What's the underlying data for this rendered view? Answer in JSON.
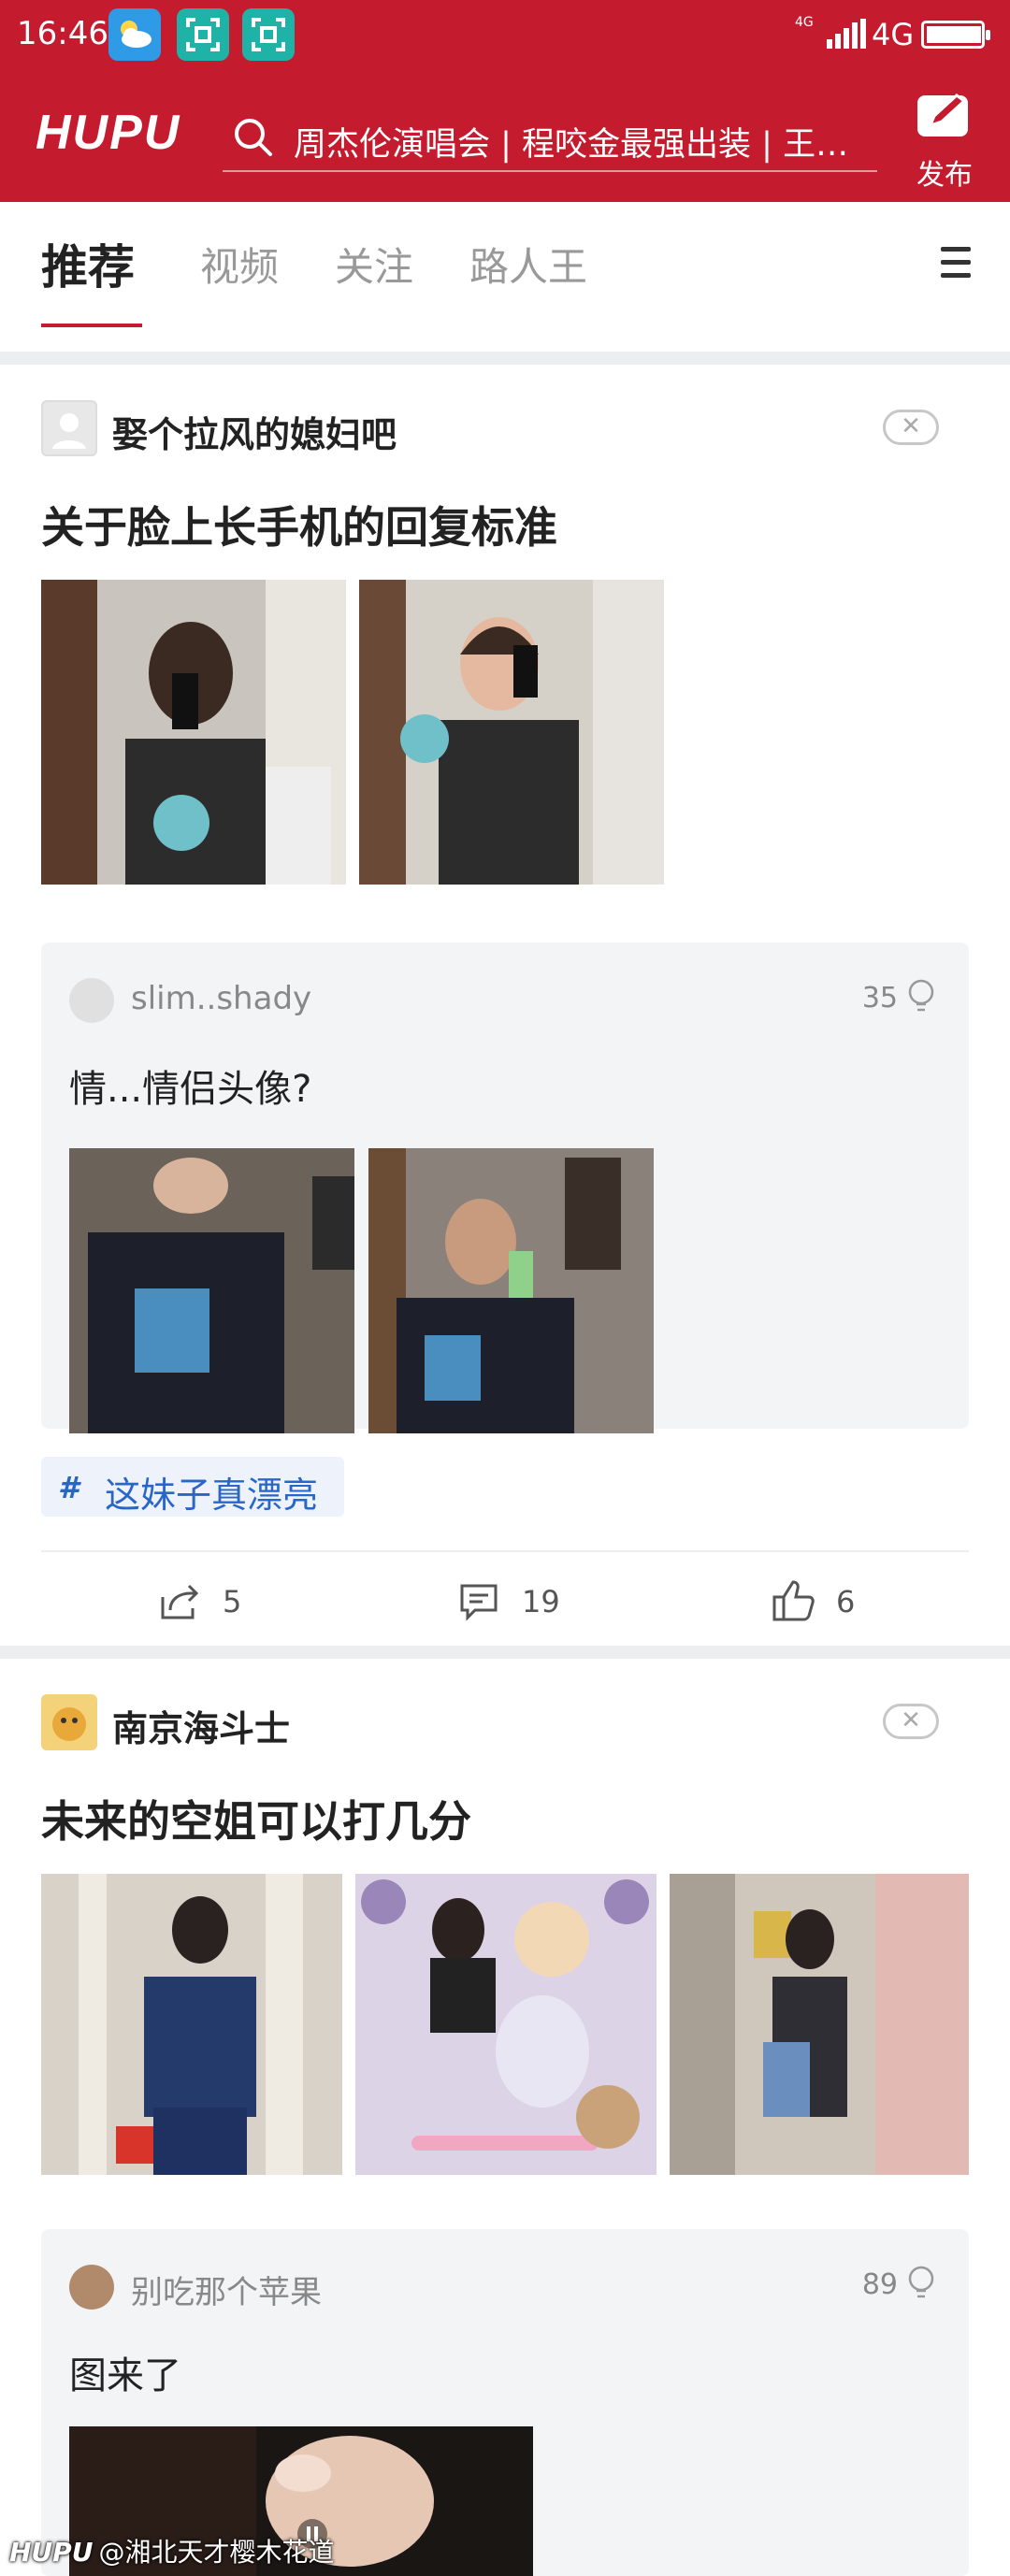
{
  "status": {
    "time": "16:46",
    "network_small": "4G",
    "network": "4G"
  },
  "header": {
    "logo": "HUPU",
    "search_text": "周杰伦演唱会 | 程咬金最强出装 | 王少...",
    "publish_label": "发布"
  },
  "tabs": [
    "推荐",
    "视频",
    "关注",
    "路人王"
  ],
  "posts": [
    {
      "author": "娶个拉风的媳妇吧",
      "title": "关于脸上长手机的回复标准",
      "reply": {
        "user": "slim..shady",
        "likes": "35",
        "text": "情...情侣头像?"
      },
      "tag": "这妹子真漂亮",
      "actions": {
        "share": "5",
        "comment": "19",
        "like": "6"
      }
    },
    {
      "author": "南京海斗士",
      "title": "未来的空姐可以打几分",
      "reply": {
        "user": "别吃那个苹果",
        "likes": "89",
        "text": "图来了"
      }
    }
  ],
  "watermark": {
    "logo": "HUPU",
    "text": "@湘北天才樱木花道"
  },
  "colors": {
    "brand": "#c41c2e",
    "tag_blue": "#2a66c8",
    "separator": "#eceeef"
  }
}
